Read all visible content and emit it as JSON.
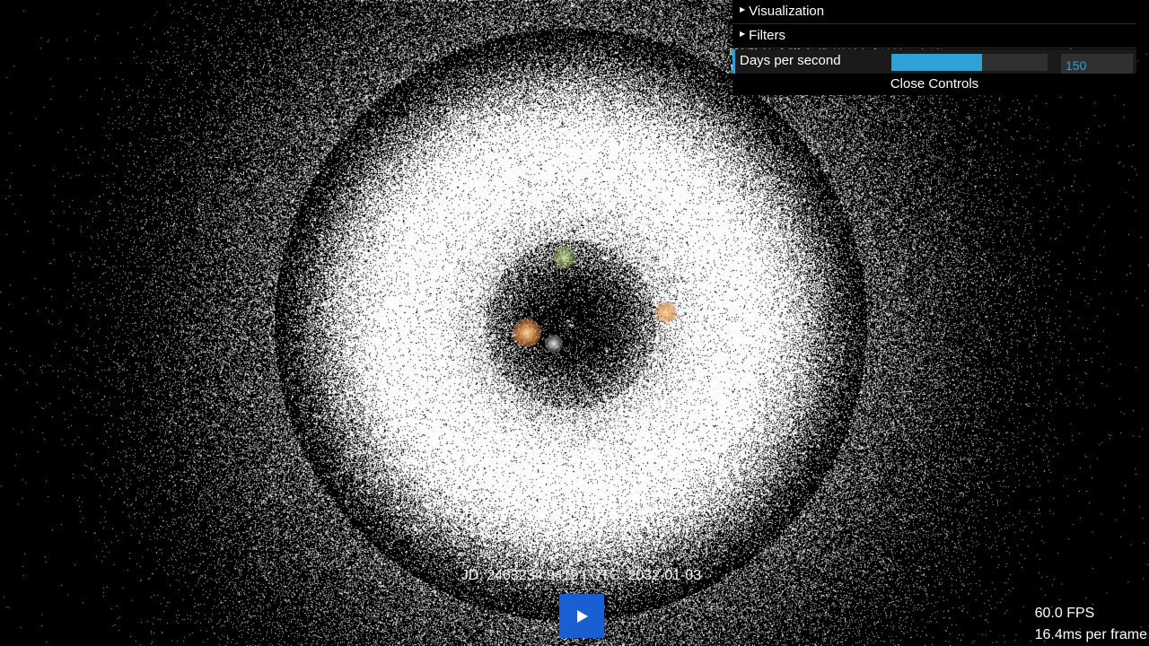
{
  "gui": {
    "folders": [
      {
        "label": "Visualization",
        "icon": "caret-right-icon"
      },
      {
        "label": "Filters",
        "icon": "caret-right-icon"
      }
    ],
    "days_per_second": {
      "label": "Days per second",
      "value": "150",
      "fill_fraction": 0.58
    },
    "close_label": "Close Controls",
    "accent_color": "#2fa1d6"
  },
  "readout": {
    "text": "JD: 2463234.9419 | UTC: 2032-01-03"
  },
  "play": {
    "icon": "play-icon",
    "color": "#1a5fd1"
  },
  "stats": {
    "fps": "60.0 FPS",
    "frame_time": "16.4ms per frame"
  }
}
